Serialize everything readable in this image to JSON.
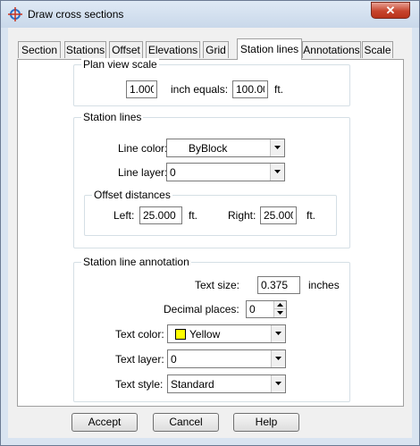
{
  "window": {
    "title": "Draw cross sections"
  },
  "tabs": [
    {
      "label": "Section"
    },
    {
      "label": "Stations"
    },
    {
      "label": "Offset"
    },
    {
      "label": "Elevations"
    },
    {
      "label": "Grid"
    },
    {
      "label": "Station lines",
      "selected": true
    },
    {
      "label": "Annotations"
    },
    {
      "label": "Scale"
    }
  ],
  "plan_view_scale": {
    "legend": "Plan view scale",
    "left_value": "1.000",
    "middle_label": "inch equals:",
    "right_value": "100.00",
    "unit": "ft."
  },
  "station_lines": {
    "legend": "Station lines",
    "line_color_label": "Line color:",
    "line_color_value": "ByBlock",
    "line_layer_label": "Line layer:",
    "line_layer_value": "0",
    "offset_distances": {
      "legend": "Offset distances",
      "left_label": "Left:",
      "left_value": "25.000",
      "left_unit": "ft.",
      "right_label": "Right:",
      "right_value": "25.000",
      "right_unit": "ft."
    }
  },
  "annotation": {
    "legend": "Station line annotation",
    "text_size_label": "Text size:",
    "text_size_value": "0.375",
    "text_size_unit": "inches",
    "decimal_places_label": "Decimal places:",
    "decimal_places_value": "0",
    "text_color_label": "Text color:",
    "text_color_value": "Yellow",
    "text_color_swatch": "#ffff00",
    "text_layer_label": "Text layer:",
    "text_layer_value": "0",
    "text_style_label": "Text style:",
    "text_style_value": "Standard"
  },
  "buttons": {
    "accept": "Accept",
    "cancel": "Cancel",
    "help": "Help"
  },
  "icons": {
    "app": "crosshair-icon",
    "close": "close-icon"
  }
}
